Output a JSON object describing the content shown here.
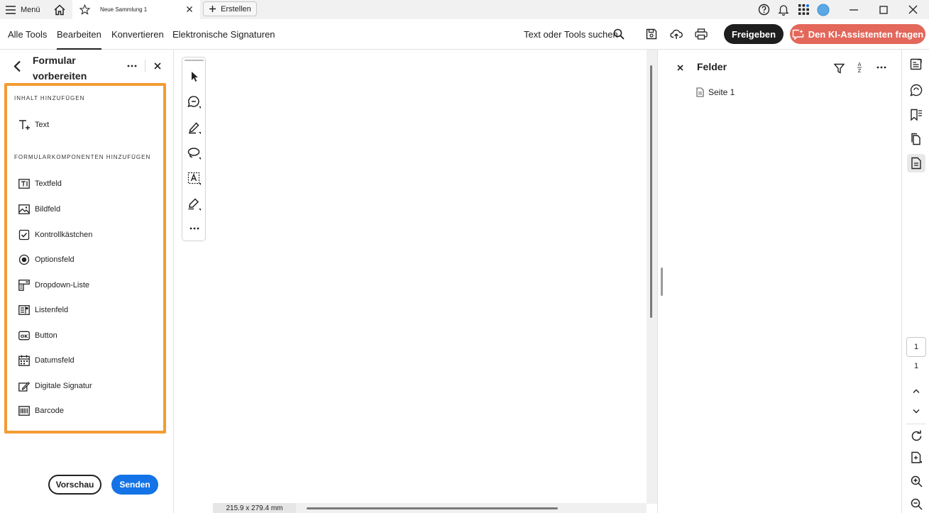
{
  "titlebar": {
    "menu_label": "Menü",
    "tab_title": "Neue Sammlung 1",
    "create_label": "Erstellen",
    "icons": [
      "hamburger-icon",
      "home-icon",
      "star-icon",
      "close-icon",
      "plus-icon",
      "help-icon",
      "bell-icon",
      "apps-grid-icon",
      "avatar",
      "minimize-icon",
      "maximize-icon",
      "close-window-icon"
    ]
  },
  "menubar": {
    "tabs": [
      {
        "label": "Alle Tools"
      },
      {
        "label": "Bearbeiten",
        "active": true
      },
      {
        "label": "Konvertieren"
      },
      {
        "label": "Elektronische Signaturen"
      }
    ],
    "search_label": "Text oder Tools suchen",
    "share_label": "Freigeben",
    "ai_label": "Den KI-Assistenten fragen",
    "colors": {
      "share": "#1e1e1e",
      "ai": "#e3675a"
    }
  },
  "leftpanel": {
    "title": "Formular vorbereiten",
    "section_content": "INHALT HINZUFÜGEN",
    "content_items": [
      {
        "label": "Text",
        "icon": "add-text-icon"
      }
    ],
    "section_components": "FORMULARKOMPONENTEN HINZUFÜGEN",
    "components": [
      {
        "label": "Textfeld",
        "icon": "textfield-icon"
      },
      {
        "label": "Bildfeld",
        "icon": "image-field-icon"
      },
      {
        "label": "Kontrollkästchen",
        "icon": "checkbox-icon"
      },
      {
        "label": "Optionsfeld",
        "icon": "radio-icon"
      },
      {
        "label": "Dropdown-Liste",
        "icon": "dropdown-icon"
      },
      {
        "label": "Listenfeld",
        "icon": "listbox-icon"
      },
      {
        "label": "Button",
        "icon": "ok-button-icon"
      },
      {
        "label": "Datumsfeld",
        "icon": "calendar-icon"
      },
      {
        "label": "Digitale Signatur",
        "icon": "signature-icon"
      },
      {
        "label": "Barcode",
        "icon": "barcode-icon"
      }
    ],
    "preview_label": "Vorschau",
    "send_label": "Senden",
    "highlight_color": "#f39c33",
    "accent": "#1473e6"
  },
  "toolbar": {
    "tools": [
      "select-icon",
      "comment-icon",
      "highlight-pen-icon",
      "lasso-icon",
      "text-select-icon",
      "fill-sign-icon",
      "more-icon"
    ]
  },
  "document": {
    "dimensions": "215.9 x 279.4 mm"
  },
  "fields_panel": {
    "title": "Felder",
    "page_entry": "Seite 1"
  },
  "rail": {
    "current_page": "1",
    "total_pages": "1"
  }
}
